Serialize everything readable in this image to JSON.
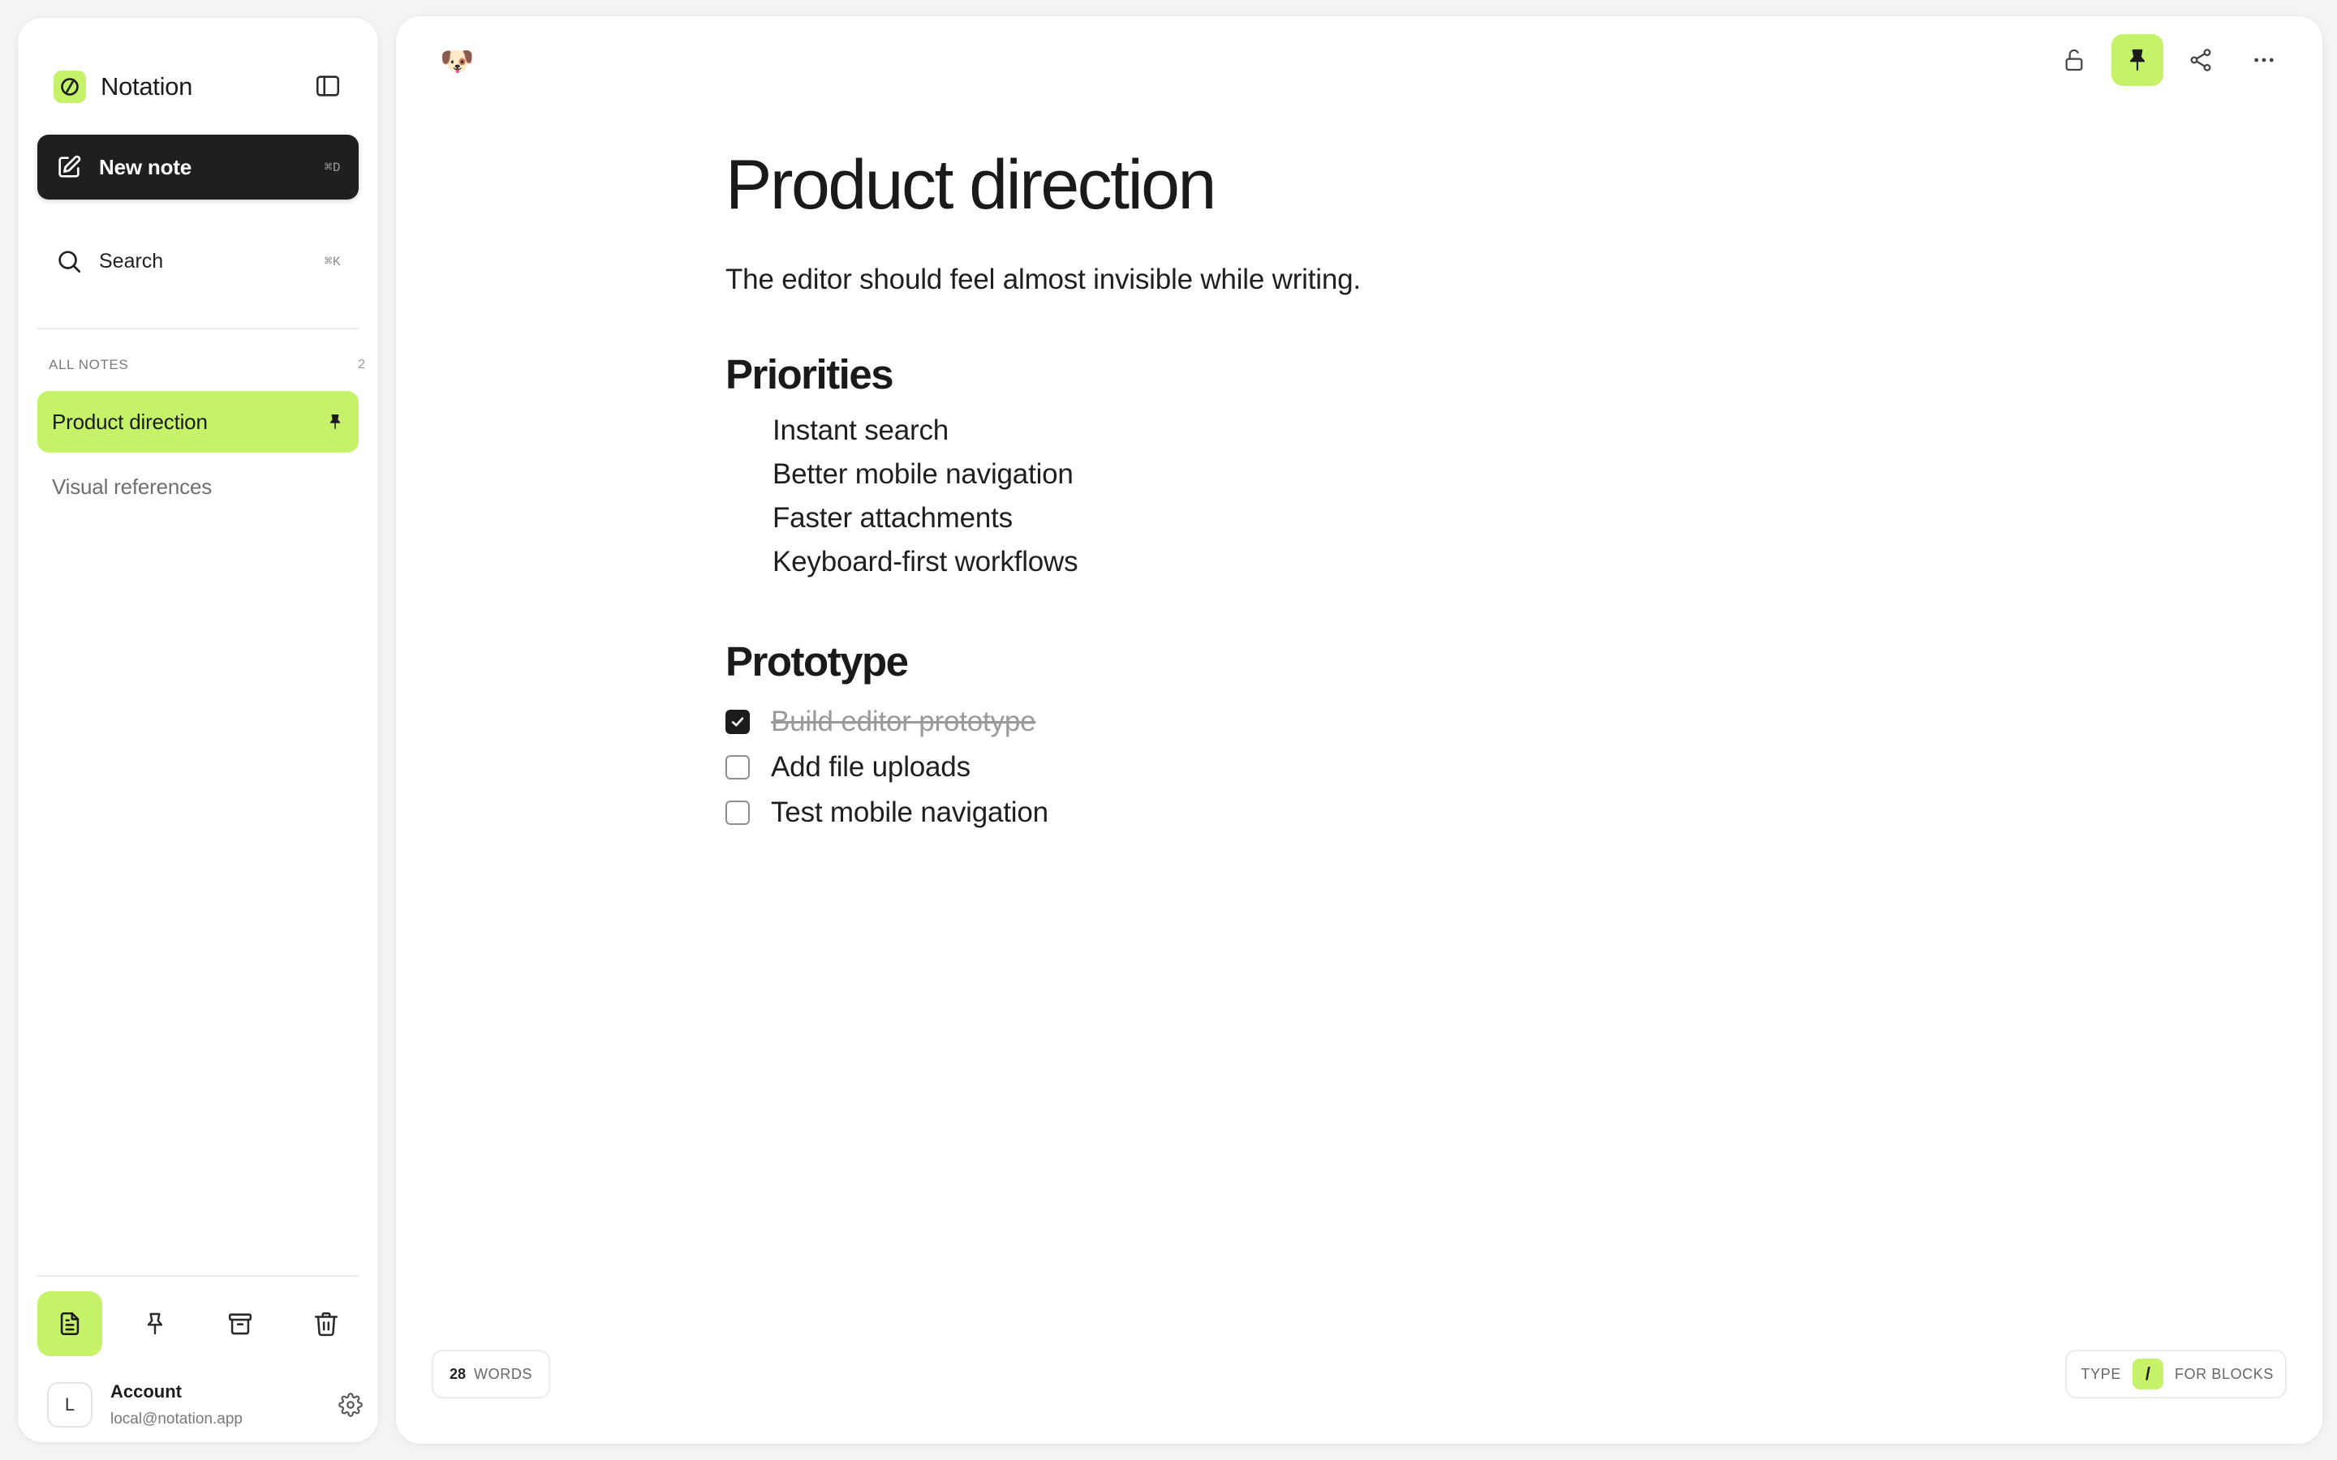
{
  "app": {
    "name": "Notation",
    "accent_color": "#c6f26a"
  },
  "sidebar": {
    "new_note": {
      "label": "New note",
      "shortcut": "⌘D",
      "icon": "edit-icon"
    },
    "search": {
      "label": "Search",
      "shortcut": "⌘K",
      "icon": "search-icon"
    },
    "section": {
      "title": "ALL NOTES",
      "count": "2"
    },
    "notes": [
      {
        "title": "Product direction",
        "active": true,
        "pinned": true
      },
      {
        "title": "Visual references",
        "active": false,
        "pinned": false
      }
    ],
    "bottom_nav": [
      {
        "name": "notes-icon",
        "active": true
      },
      {
        "name": "pin-icon",
        "active": false
      },
      {
        "name": "archive-icon",
        "active": false
      },
      {
        "name": "trash-icon",
        "active": false
      }
    ],
    "account": {
      "initial": "L",
      "name": "Account",
      "email": "local@notation.app"
    }
  },
  "note": {
    "emoji": "🐶",
    "title": "Product direction",
    "subtitle": "The editor should feel almost invisible while writing.",
    "sections": [
      {
        "heading": "Priorities",
        "bullets": [
          "Instant search",
          "Better mobile navigation",
          "Faster attachments",
          "Keyboard-first workflows"
        ]
      },
      {
        "heading": "Prototype",
        "tasks": [
          {
            "label": "Build editor prototype",
            "done": true
          },
          {
            "label": "Add file uploads",
            "done": false
          },
          {
            "label": "Test mobile navigation",
            "done": false
          }
        ]
      }
    ]
  },
  "toolbar": {
    "buttons": [
      {
        "name": "lock-icon",
        "active": false
      },
      {
        "name": "pin-icon",
        "active": true
      },
      {
        "name": "share-icon",
        "active": false
      },
      {
        "name": "more-icon",
        "active": false
      }
    ]
  },
  "footer": {
    "word_count": "28",
    "word_unit": "WORDS",
    "hint_prefix": "TYPE",
    "hint_key": "/",
    "hint_suffix": "FOR BLOCKS"
  }
}
